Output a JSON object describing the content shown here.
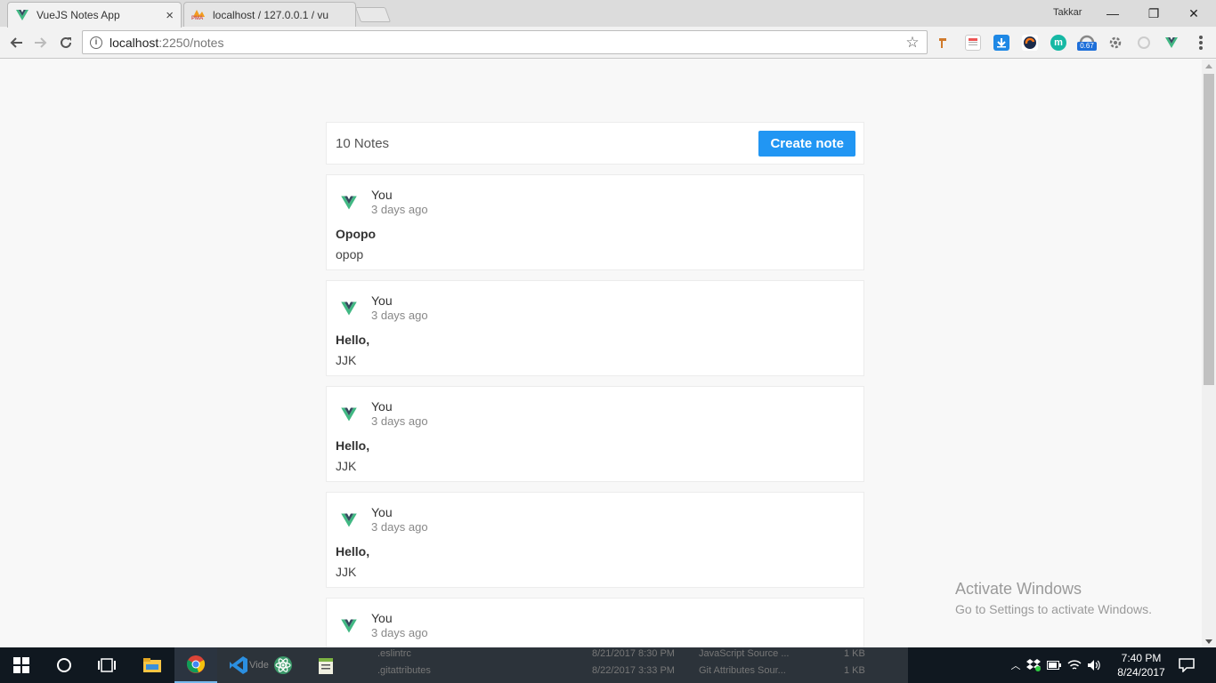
{
  "browser": {
    "tabs": [
      {
        "label": "VueJS Notes App",
        "icon": "vue-icon",
        "close": "×"
      },
      {
        "label": "localhost / 127.0.0.1 / vu",
        "icon": "phpmyadmin-icon",
        "favicon_text": "PMA",
        "close": ""
      }
    ],
    "profile_name": "Takkar",
    "window_controls": {
      "minimize": "—",
      "restore": "❐",
      "close": "✕"
    },
    "url_host": "localhost",
    "url_path": ":2250/notes",
    "extensions": [
      "ext-bookmark-icon",
      "ext-notes-icon",
      "ext-download-icon",
      "ext-s-icon",
      "ext-m-icon",
      "ext-speed-icon",
      "ext-gear-icon",
      "ext-circle-icon",
      "vue-devtools-icon"
    ],
    "speed_badge": "0.67",
    "m_badge": "m"
  },
  "page": {
    "notes_count": "10 Notes",
    "create_button": "Create note",
    "notes": [
      {
        "author": "You",
        "time": "3 days ago",
        "title": "Opopo",
        "body": "opop"
      },
      {
        "author": "You",
        "time": "3 days ago",
        "title": "Hello,",
        "body": "JJK"
      },
      {
        "author": "You",
        "time": "3 days ago",
        "title": "Hello,",
        "body": "JJK"
      },
      {
        "author": "You",
        "time": "3 days ago",
        "title": "Hello,",
        "body": "JJK"
      },
      {
        "author": "You",
        "time": "3 days ago",
        "title": "",
        "body": ""
      }
    ]
  },
  "watermark": {
    "line1": "Activate Windows",
    "line2": "Go to Settings to activate Windows."
  },
  "taskbar": {
    "peek_rows": [
      {
        "name": ".eslintrc",
        "date": "8/21/2017 8:30 PM",
        "type": "JavaScript Source ...",
        "size": "1 KB"
      },
      {
        "name": ".gitattributes",
        "date": "8/22/2017 3:33 PM",
        "type": "Git Attributes Sour...",
        "size": "1 KB"
      }
    ],
    "peek_video": "Vide",
    "clock_time": "7:40 PM",
    "clock_date": "8/24/2017"
  },
  "colors": {
    "accent": "#2196f3",
    "vue_green": "#41b883",
    "vue_dark": "#35495e"
  }
}
